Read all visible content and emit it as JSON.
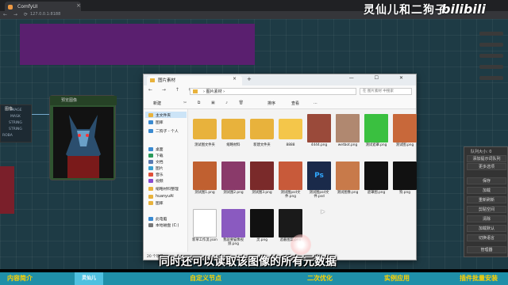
{
  "browser": {
    "tab_title": "ComfyUI",
    "tab_close": "×",
    "address": "127.0.0.1:8188",
    "nav_icons": "← → ⟳"
  },
  "watermark": {
    "text": "灵仙儿和二狗子",
    "logo": "bilibili"
  },
  "canvas": {
    "left_node_labels": [
      "IMAGE",
      "MASK",
      "STRING",
      "STRING",
      "ROBA"
    ],
    "preview_node_title": "预览图像",
    "preview_sub": "图像"
  },
  "explorer": {
    "tab_title": "图片素材",
    "tab_close": "×",
    "new_tab": "+",
    "window_controls": "— ☐ ✕",
    "nav_arrows": "← → ↑ ⟳",
    "path": "›  图片素材  ›",
    "search_placeholder": "在 图片素材 中搜索",
    "toolbar": {
      "new": "新建",
      "sort": "排序",
      "view": "查看",
      "more": "..."
    },
    "sidebar": [
      {
        "label": "主文件夹",
        "icon": "home-icon",
        "color": "#e8b23c"
      },
      {
        "label": "图库",
        "icon": "gallery-icon",
        "color": "#3a8ad0"
      },
      {
        "label": "二狗子 - 个人",
        "icon": "cloud-icon",
        "color": "#3a8ad0"
      },
      {
        "label": "桌面",
        "icon": "desktop-icon",
        "color": "#3a8ad0"
      },
      {
        "label": "下载",
        "icon": "download-icon",
        "color": "#2a9a5a"
      },
      {
        "label": "文档",
        "icon": "document-icon",
        "color": "#5a7ab0"
      },
      {
        "label": "图片",
        "icon": "picture-icon",
        "color": "#3aa0d0"
      },
      {
        "label": "音乐",
        "icon": "music-icon",
        "color": "#e0503a"
      },
      {
        "label": "视频",
        "icon": "video-icon",
        "color": "#8a4ad0"
      },
      {
        "label": "缩略材料整理",
        "icon": "folder-icon",
        "color": "#e8b23c"
      },
      {
        "label": "huanyuAI",
        "icon": "folder-icon",
        "color": "#e8b23c"
      },
      {
        "label": "图库",
        "icon": "folder-icon",
        "color": "#e8b23c"
      },
      {
        "label": "此电脑",
        "icon": "computer-icon",
        "color": "#3a8ad0"
      },
      {
        "label": "本地磁盘 (C:)",
        "icon": "drive-icon",
        "color": "#777"
      }
    ],
    "files": [
      {
        "name": "测试图文件夹",
        "type": "folder",
        "color": "#e8b23c"
      },
      {
        "name": "缩略材料",
        "type": "folder",
        "color": "#e8b23c"
      },
      {
        "name": "新建文件夹",
        "type": "folder",
        "color": "#e8b23c"
      },
      {
        "name": "8888",
        "type": "folder",
        "color": "#f4c64a"
      },
      {
        "name": "4444.png",
        "type": "image",
        "color": "#9a4a3a"
      },
      {
        "name": "wetbot.png",
        "type": "image",
        "color": "#b08870"
      },
      {
        "name": "测试遮罩.png",
        "type": "image",
        "color": "#3ac040"
      },
      {
        "name": "测试图.png",
        "type": "image",
        "color": "#c8683a"
      },
      {
        "name": "测试图1.png",
        "type": "image",
        "color": "#c06030"
      },
      {
        "name": "测试图2.png",
        "type": "image",
        "color": "#8a3a6a"
      },
      {
        "name": "测试图3.png",
        "type": "image",
        "color": "#7a2a2a"
      },
      {
        "name": "测试图psd文件.png",
        "type": "image",
        "color": "#c85a3a"
      },
      {
        "name": "测试图psd文件.psd",
        "type": "psd",
        "color": "#1a2a4a"
      },
      {
        "name": "测试图像.png",
        "type": "image",
        "color": "#c87a4a"
      },
      {
        "name": "遮罩图.png",
        "type": "image",
        "color": "#111111"
      },
      {
        "name": "狗.png",
        "type": "image",
        "color": "#111111"
      },
      {
        "name": "新草工作流.json",
        "type": "json",
        "color": "#ffffff"
      },
      {
        "name": "我就要猫像视频.png",
        "type": "image",
        "color": "#8a5ac0"
      },
      {
        "name": "灵.png",
        "type": "image",
        "color": "#111111"
      },
      {
        "name": "遮蔽图案.png",
        "type": "image",
        "color": "#1a1a1a"
      }
    ],
    "status": "20 个项目"
  },
  "right_menu": {
    "title": "队列大小: 0",
    "items": [
      "添加提示词队列",
      "更多选项",
      "保存",
      "加载",
      "重新刷新",
      "剪贴空间",
      "清除",
      "加载默认",
      "切换语言",
      "管理器"
    ]
  },
  "subtitle": "同时还可以读取该图像的所有元数据",
  "bottom_nav": [
    "内容简介",
    "自定义节点",
    "二次优化",
    "实例应用",
    "插件批量安装"
  ],
  "bottom_logo": "灵仙儿"
}
